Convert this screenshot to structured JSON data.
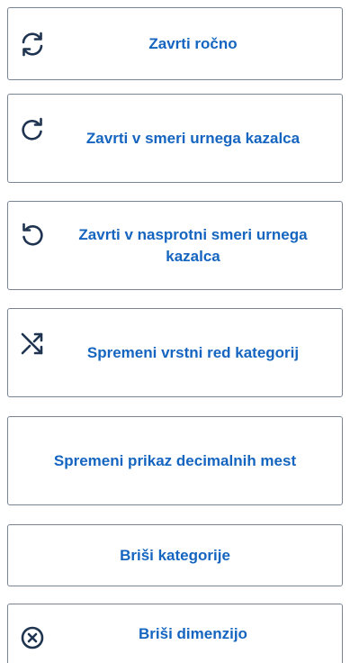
{
  "colors": {
    "accent": "#1565c0",
    "icon": "#1f3450",
    "border": "#7a8594",
    "background": "#ffffff"
  },
  "buttons": [
    {
      "id": "rotate-manual",
      "label": "Zavrti ročno",
      "icon": "rotate-both-icon"
    },
    {
      "id": "rotate-cw",
      "label": "Zavrti v smeri urnega kazalca",
      "icon": "rotate-clockwise-icon"
    },
    {
      "id": "rotate-ccw",
      "label": "Zavrti v nasprotni smeri urnega kazalca",
      "icon": "rotate-counterclockwise-icon"
    },
    {
      "id": "reorder-categories",
      "label": "Spremeni vrstni red kategorij",
      "icon": "shuffle-icon"
    },
    {
      "id": "decimal-places",
      "label": "Spremeni prikaz decimalnih mest",
      "icon": ""
    },
    {
      "id": "delete-categories",
      "label": "Briši kategorije",
      "icon": ""
    },
    {
      "id": "delete-dimension",
      "label": "Briši dimenzijo",
      "icon": "close-circle-icon"
    }
  ]
}
